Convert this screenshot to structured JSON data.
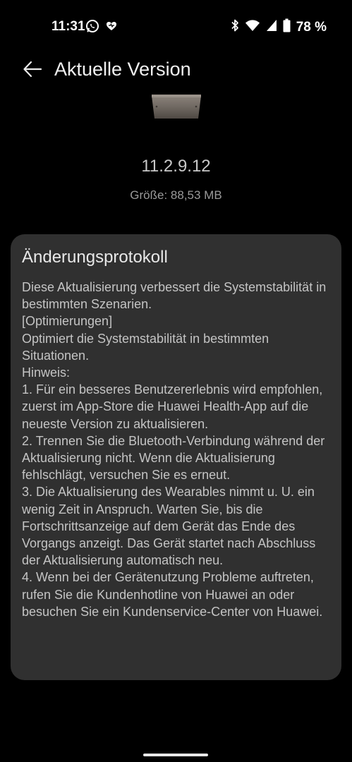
{
  "status_bar": {
    "time": "11:31",
    "battery": "78 %",
    "left_icons": [
      "whatsapp-icon",
      "heart-notification-icon"
    ],
    "right_icons": [
      "bluetooth-icon",
      "wifi-icon",
      "signal-icon",
      "battery-icon"
    ]
  },
  "header": {
    "title": "Aktuelle Version",
    "back_icon": "arrow-left-icon"
  },
  "version": {
    "number": "11.2.9.12",
    "size": "Größe: 88,53 MB"
  },
  "changelog": {
    "title": "Änderungsprotokoll",
    "body": "Diese Aktualisierung verbessert die Systemstabilität in bestimmten Szenarien.\n[Optimierungen]\nOptimiert die Systemstabilität in bestimmten Situationen.\nHinweis:\n1. Für ein besseres Benutzererlebnis wird empfohlen, zuerst im App-Store die Huawei Health-App auf die neueste Version zu aktualisieren.\n2. Trennen Sie die Bluetooth-Verbindung während der Aktualisierung nicht. Wenn die Aktualisierung fehlschlägt, versuchen Sie es erneut.\n3. Die Aktualisierung des Wearables nimmt u. U. ein wenig Zeit in Anspruch. Warten Sie, bis die Fortschrittsanzeige auf dem Gerät das Ende des Vorgangs anzeigt. Das Gerät startet nach Abschluss der Aktualisierung automatisch neu.\n4. Wenn bei der Gerätenutzung Probleme auftreten, rufen Sie die Kundenhotline von Huawei an oder besuchen Sie ein Kundenservice-Center von Huawei."
  },
  "colors": {
    "background": "#000000",
    "card": "#303030",
    "title_text": "#f0f0f0",
    "body_text": "#c4c4c4"
  }
}
